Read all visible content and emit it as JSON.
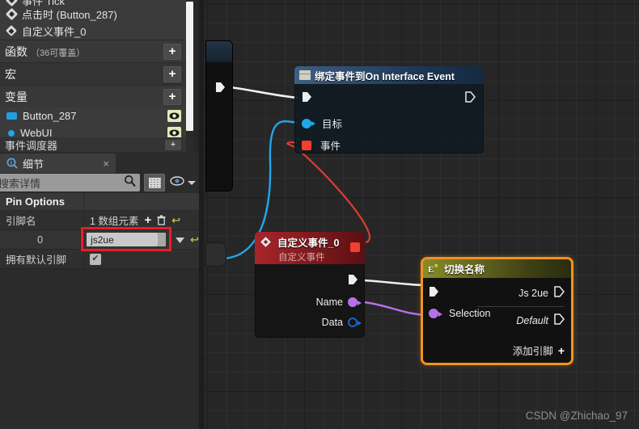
{
  "blueprint_panel": {
    "events": [
      {
        "label": "事件 Tick",
        "icon": "event-diamond-icon"
      },
      {
        "label": "点击时 (Button_287)",
        "icon": "event-diamond-icon"
      },
      {
        "label": "自定义事件_0",
        "icon": "custom-event-diamond-icon"
      }
    ],
    "sections": [
      {
        "label": "函数",
        "sub": "（36可覆盖）",
        "add_label": "+"
      },
      {
        "label": "宏",
        "sub": "",
        "add_label": "+"
      },
      {
        "label": "变量",
        "sub": "",
        "add_label": "+"
      }
    ],
    "variables": [
      {
        "label": "Button_287",
        "icon": "widget-swatch-icon"
      },
      {
        "label": "WebUI",
        "icon": "object-swatch-icon"
      }
    ],
    "bottom_section": {
      "label": "事件调度器",
      "add_label": "+"
    }
  },
  "details_panel": {
    "tab": {
      "label": "细节",
      "icon": "details-info-icon",
      "close": "×"
    },
    "search": {
      "placeholder": "搜索详情",
      "icon": "search-icon"
    },
    "toolbar": {
      "grid_icon": "grid-view-icon",
      "eye_icon": "eye-icon",
      "caret": "chevron-down-icon"
    },
    "category": {
      "label": "Pin Options"
    },
    "rows": [
      {
        "label": "引脚名",
        "value": "1 数组元素",
        "actions": [
          "add-icon",
          "delete-icon",
          "reset-icon"
        ]
      },
      {
        "label": "0",
        "value": "js2ue",
        "highlighted": true,
        "actions": [
          "dropdown-icon",
          "reset-icon"
        ]
      },
      {
        "label": "拥有默认引脚",
        "value": "",
        "checkbox": true,
        "checkmark": "✔"
      }
    ]
  },
  "graph": {
    "nodes": {
      "bind_event": {
        "title": "绑定事件到On Interface Event",
        "icon": "function-node-icon",
        "exec_in": "exec-in-pin",
        "exec_out": "exec-out-pin",
        "inputs": [
          {
            "label": "目标",
            "pin": "object-pin"
          },
          {
            "label": "事件",
            "pin": "delegate-pin"
          }
        ]
      },
      "custom_event": {
        "title": "自定义事件_0",
        "subtitle": "自定义事件",
        "icon": "custom-event-icon",
        "delegate_pin": "delegate-output-pin",
        "outputs": [
          {
            "label": "Name",
            "pin": "name-pin"
          },
          {
            "label": "Data",
            "pin": "struct-pin"
          }
        ]
      },
      "switch_node": {
        "title": "切换名称",
        "icon": "switch-enum-icon",
        "selected": true,
        "exec_in": "exec-in-pin",
        "inputs": [
          {
            "label": "Selection",
            "pin": "name-pin"
          }
        ],
        "outputs": [
          {
            "label": "Js 2ue",
            "pin": "exec-out-pin",
            "italic": false
          },
          {
            "label": "Default",
            "pin": "exec-out-pin",
            "italic": true
          }
        ],
        "add_pin": {
          "label": "添加引脚",
          "icon": "add-pin-icon"
        }
      }
    },
    "watermark": "CSDN @Zhichao_97"
  },
  "colors": {
    "selection_orange": "#f0931e",
    "highlight_red": "#ee1c25",
    "exec_white": "#e8e8e8",
    "object_blue": "#1fa8ec",
    "delegate_red": "#f2402f",
    "name_purple": "#b571e8",
    "struct_blue": "#1d64c8"
  }
}
